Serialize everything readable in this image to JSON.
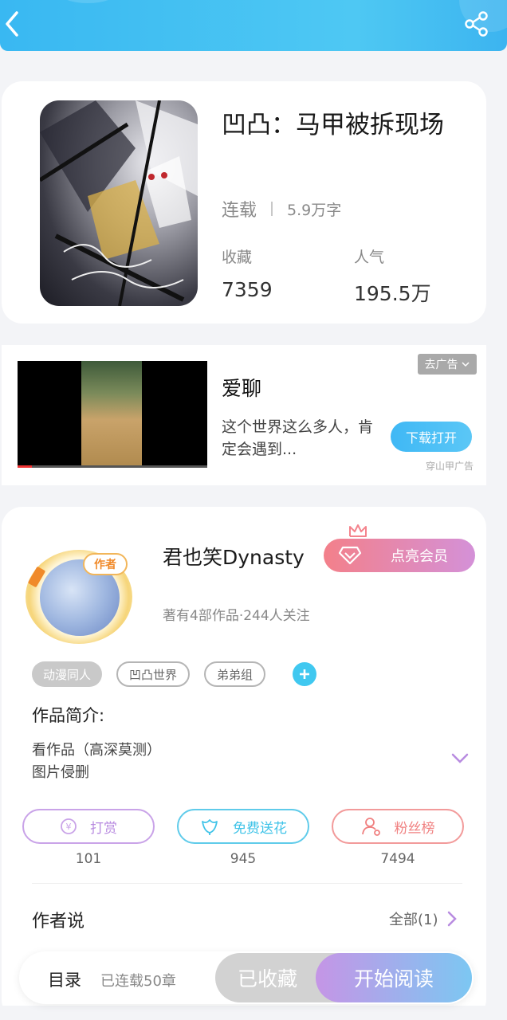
{
  "header": {
    "back_icon": "chevron-left-icon",
    "share_icon": "share-icon"
  },
  "book": {
    "title": "凹凸：马甲被拆现场",
    "status": "连载",
    "word_count": "5.9万字",
    "stats": [
      {
        "label": "收藏",
        "value": "7359"
      },
      {
        "label": "人气",
        "value": "195.5万"
      }
    ]
  },
  "ad": {
    "name": "爱聊",
    "description": "这个世界这么多人，肯定会遇到...",
    "remove_label": "去广告",
    "download_label": "下载打开",
    "source": "穿山甲广告"
  },
  "author": {
    "badge": "作者",
    "name": "君也笑Dynasty",
    "vip_label": "点亮会员",
    "meta": "著有4部作品·244人关注",
    "tags": [
      "动漫同人",
      "凹凸世界",
      "弟弟组"
    ]
  },
  "intro": {
    "title": "作品简介:",
    "lines": [
      "看作品（高深莫测）",
      "图片侵删"
    ]
  },
  "actions": [
    {
      "label": "打赏",
      "count": "101",
      "color": "#b88be0"
    },
    {
      "label": "免费送花",
      "count": "945",
      "color": "#3fc3e8"
    },
    {
      "label": "粉丝榜",
      "count": "7494",
      "color": "#f08080"
    }
  ],
  "author_says": {
    "title": "作者说",
    "view_all": "全部(1)"
  },
  "bottom": {
    "toc": "目录",
    "toc_status": "已连载50章",
    "collected": "已收藏",
    "read": "开始阅读"
  },
  "colors": {
    "header": "#3fbcf2",
    "accent": "#40c8f0",
    "vip_start": "#f3808a",
    "vip_end": "#d491d8"
  }
}
